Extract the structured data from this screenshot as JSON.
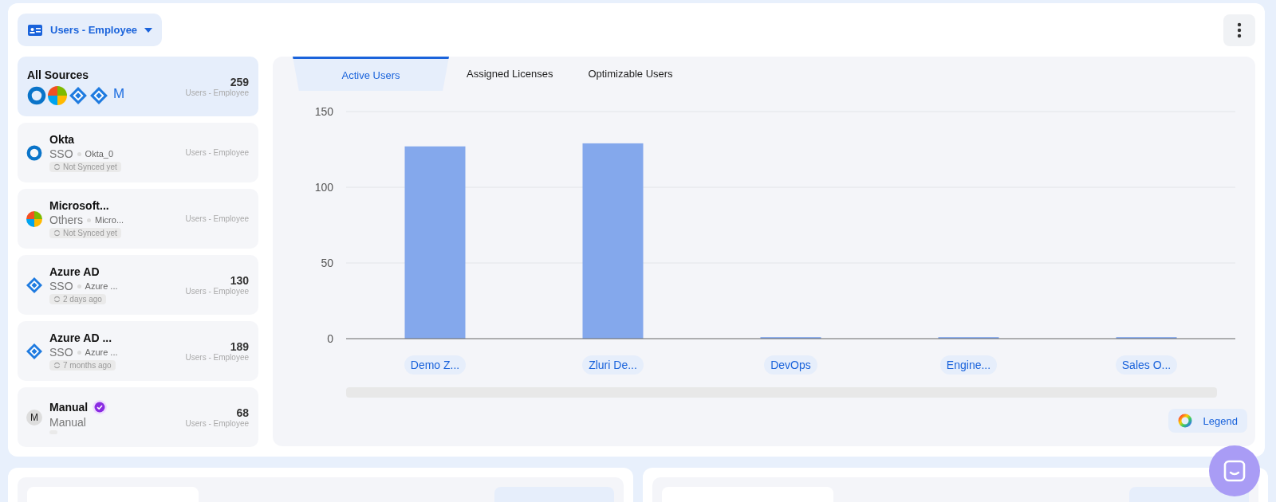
{
  "header": {
    "view_button": "Users - Employee"
  },
  "sources": [
    {
      "kind": "all",
      "name": "All Sources",
      "icons": [
        {
          "kind": "ring"
        },
        {
          "kind": "quad"
        },
        {
          "kind": "diamond"
        },
        {
          "kind": "diamond"
        },
        {
          "kind": "letter",
          "letter": "M"
        }
      ],
      "count": "259",
      "count_label": "Users - Employee",
      "selected": true
    },
    {
      "kind": "ring",
      "name": "Okta",
      "type": "SSO",
      "instance": "Okta_0",
      "sync": "Not Synced yet",
      "count_label": "Users - Employee",
      "selected": false
    },
    {
      "kind": "quad",
      "name": "Microsoft...",
      "type": "Others",
      "instance": "Micro...",
      "sync": "Not Synced yet",
      "count_label": "Users - Employee",
      "selected": false
    },
    {
      "kind": "diamond",
      "name": "Azure AD",
      "type": "SSO",
      "instance": "Azure ...",
      "sync": "2 days ago",
      "count": "130",
      "count_label": "Users - Employee",
      "selected": false
    },
    {
      "kind": "diamond",
      "name": "Azure AD ...",
      "type": "SSO",
      "instance": "Azure ...",
      "sync": "7 months ago",
      "count": "189",
      "count_label": "Users - Employee",
      "selected": false
    },
    {
      "kind": "letter",
      "icon_letter": "M",
      "name": "Manual",
      "verified": true,
      "type": "Manual",
      "count": "68",
      "count_label": "Users - Employee",
      "selected": false
    }
  ],
  "tabs": [
    {
      "label": "Active Users",
      "selected": true
    },
    {
      "label": "Assigned Licenses",
      "selected": false
    },
    {
      "label": "Optimizable Users",
      "selected": false
    }
  ],
  "chart_data": {
    "type": "bar",
    "categories": [
      "Demo Z...",
      "Zluri De...",
      "DevOps",
      "Engine...",
      "Sales O..."
    ],
    "series": [
      {
        "color": "#84a8ec",
        "values": [
          127,
          129,
          1,
          1,
          1
        ]
      }
    ],
    "ylim": [
      0,
      150
    ],
    "yticks": [
      0,
      50,
      100,
      150
    ]
  },
  "legend_button": "Legend"
}
